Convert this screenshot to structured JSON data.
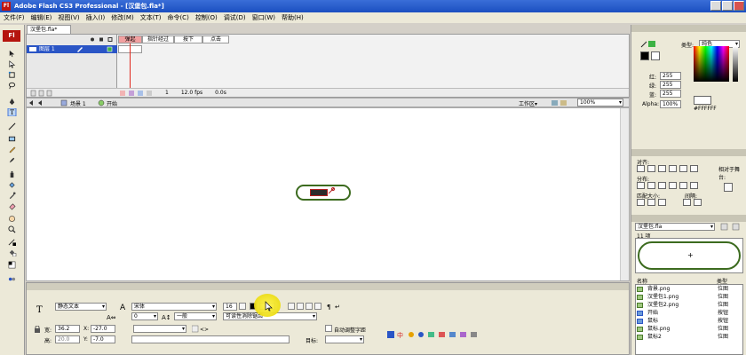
{
  "window": {
    "title": "Adobe Flash CS3 Professional - [汉堡包.fla*]",
    "logo": "Fl"
  },
  "menu": [
    "文件(F)",
    "编辑(E)",
    "视图(V)",
    "插入(I)",
    "修改(M)",
    "文本(T)",
    "命令(C)",
    "控制(O)",
    "调试(D)",
    "窗口(W)",
    "帮助(H)"
  ],
  "tools": {
    "logo": "Fl"
  },
  "document": {
    "tab": "汉堡包.fla*"
  },
  "timeline": {
    "labels": [
      "弹起",
      "指针经过",
      "按下",
      "点击"
    ],
    "layer_name": "图层 1",
    "frame": "1",
    "fps": "12.0 fps",
    "time": "0.0s"
  },
  "editbar": {
    "scene": "场景 1",
    "symbol": "开始",
    "workspace": "工作区▾",
    "zoom": "100%"
  },
  "properties": {
    "text_type": "静态文本",
    "font": "宋体",
    "font_size": "16",
    "tracking": "0",
    "position": "一般",
    "antialias": "可读性消除锯齿",
    "w": "36.2",
    "x": "-27.0",
    "h": "20.0",
    "y": "-7.0",
    "auto_kern": "自动调整字距",
    "target_label": "目标:",
    "labels": {
      "w": "宽:",
      "x": "X:",
      "h": "高:",
      "y": "Y:"
    }
  },
  "color_panel": {
    "type_label": "类型:",
    "type_value": "纯色",
    "r_label": "红:",
    "r": "255",
    "g_label": "绿:",
    "g": "255",
    "b_label": "蓝:",
    "b": "255",
    "alpha_label": "Alpha:",
    "alpha": "100%",
    "hex": "#FFFFFF"
  },
  "align_panel": {
    "align_label": "对齐:",
    "distribute_label": "分布:",
    "match_label": "匹配大小:",
    "spacing_label": "间隔:",
    "to_stage_label": "相对于舞台:"
  },
  "library": {
    "file": "汉堡包.fla",
    "count": "11 项",
    "col_name": "名称",
    "col_type": "类型",
    "items": [
      {
        "name": "背景.png",
        "type": "位图"
      },
      {
        "name": "汉堡包1.png",
        "type": "位图"
      },
      {
        "name": "汉堡包2.png",
        "type": "位图"
      },
      {
        "name": "开始",
        "type": "按钮"
      },
      {
        "name": "鼠标",
        "type": "按钮"
      },
      {
        "name": "鼠标.png",
        "type": "位图"
      },
      {
        "name": "鼠标2",
        "type": "位图"
      }
    ]
  },
  "colors": {
    "titlebar": "#1b4fc0",
    "accent_red": "#e0261b",
    "button_outline": "#3c6b1f"
  }
}
